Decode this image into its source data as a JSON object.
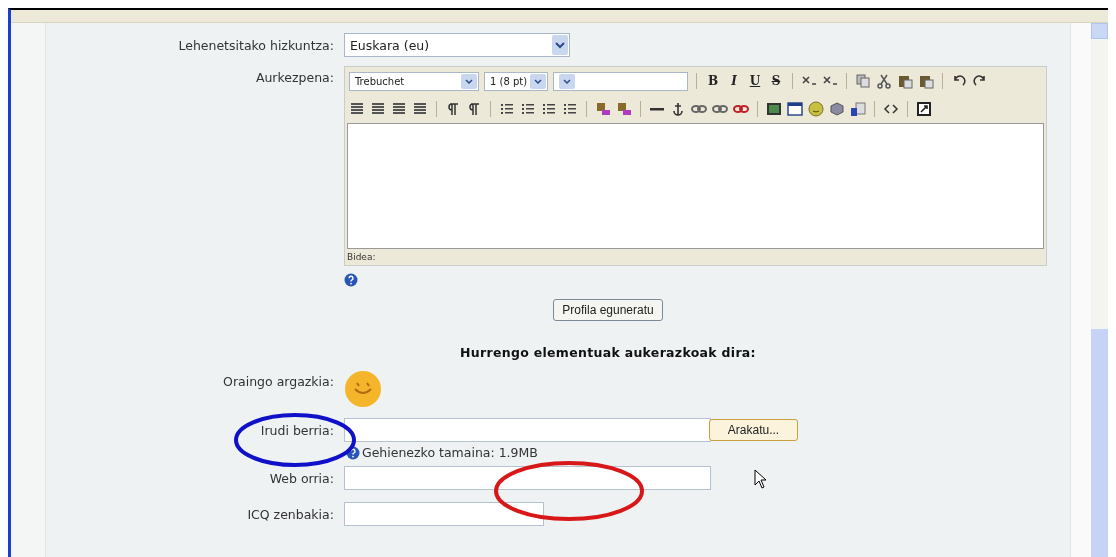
{
  "language": {
    "label": "Lehenetsitako hizkuntza:",
    "value": "Euskara (eu)"
  },
  "editor": {
    "label": "Aurkezpena:",
    "font": "Trebuchet",
    "size": "1 (8 pt)",
    "format_buttons": [
      "B",
      "I",
      "U",
      "S"
    ],
    "path_label": "Bidea:"
  },
  "submit_button": "Profila eguneratu",
  "optional_heading": "Hurrengo elementuak aukerazkoak dira:",
  "current_picture": {
    "label": "Oraingo argazkia:"
  },
  "new_picture": {
    "label": "Irudi berria:",
    "browse_button": "Arakatu...",
    "hint": "Gehienezko tamaina: 1.9MB"
  },
  "web_page": {
    "label": "Web orria:"
  },
  "icq": {
    "label": "ICQ zenbakia:"
  }
}
